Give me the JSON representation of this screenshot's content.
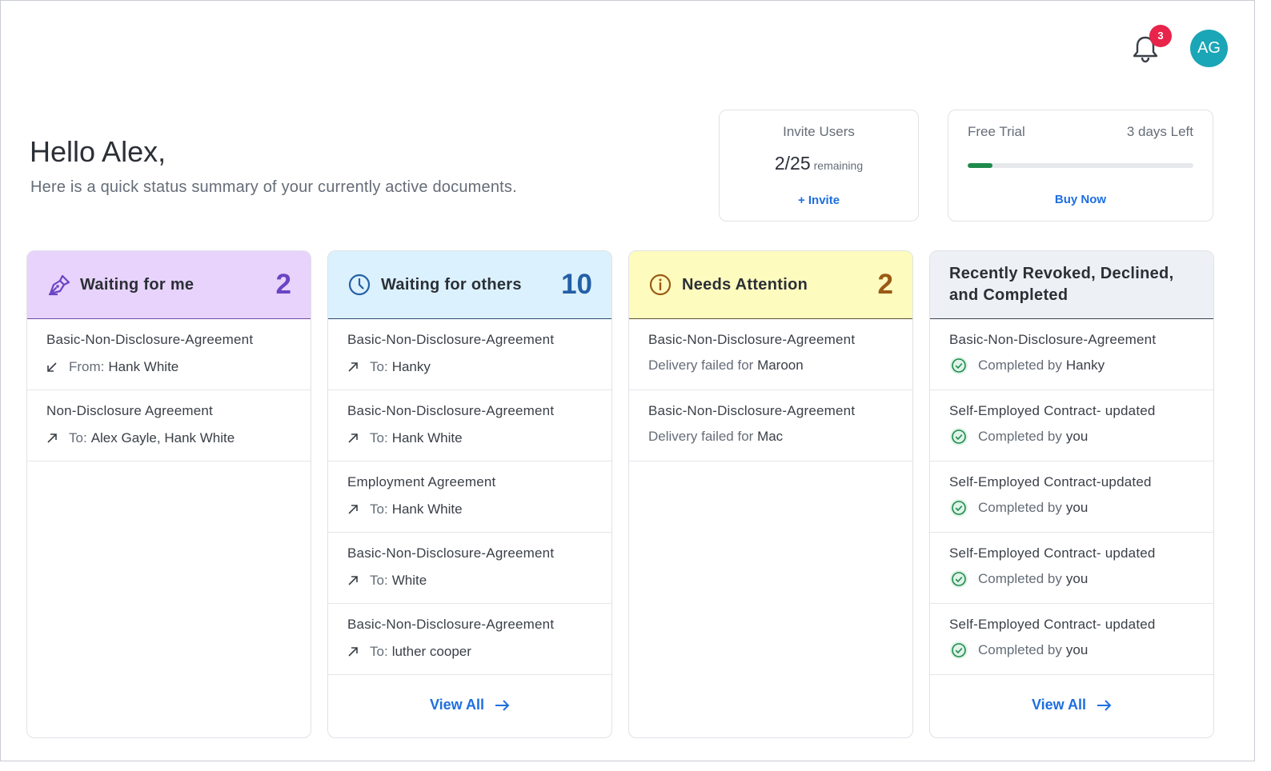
{
  "header": {
    "notification_count": "3",
    "avatar_initials": "AG"
  },
  "greeting": {
    "title": "Hello Alex,",
    "subtitle": "Here is a quick status summary of your currently active documents."
  },
  "invite_card": {
    "title": "Invite Users",
    "count": "2/25",
    "remaining_label": "remaining",
    "action": "+ Invite"
  },
  "trial_card": {
    "title": "Free Trial",
    "days_left": "3 days Left",
    "progress_fraction": 0.11,
    "action": "Buy Now",
    "progress_color": "#1e8a4c"
  },
  "columns": [
    {
      "title": "Waiting for me",
      "count": "2",
      "icon": "pen-icon",
      "accent": "#6b44c4",
      "items": [
        {
          "title": "Basic-Non-Disclosure-Agreement",
          "prefix": "From:",
          "who": "Hank White",
          "icon": "arrow-down-left-icon"
        },
        {
          "title": "Non-Disclosure Agreement",
          "prefix": "To:",
          "who": "Alex Gayle, Hank White",
          "icon": "arrow-up-right-icon"
        }
      ]
    },
    {
      "title": "Waiting for others",
      "count": "10",
      "icon": "clock-icon",
      "accent": "#245fa6",
      "items": [
        {
          "title": "Basic-Non-Disclosure-Agreement",
          "prefix": "To:",
          "who": "Hanky",
          "icon": "arrow-up-right-icon"
        },
        {
          "title": "Basic-Non-Disclosure-Agreement",
          "prefix": "To:",
          "who": "Hank White",
          "icon": "arrow-up-right-icon"
        },
        {
          "title": "Employment Agreement",
          "prefix": "To:",
          "who": "Hank White",
          "icon": "arrow-up-right-icon"
        },
        {
          "title": "Basic-Non-Disclosure-Agreement",
          "prefix": "To:",
          "who": "White",
          "icon": "arrow-up-right-icon"
        },
        {
          "title": "Basic-Non-Disclosure-Agreement",
          "prefix": "To:",
          "who": "luther cooper",
          "icon": "arrow-up-right-icon"
        }
      ],
      "view_all": "View All"
    },
    {
      "title": "Needs Attention",
      "count": "2",
      "icon": "info-icon",
      "accent": "#9a5a14",
      "items": [
        {
          "title": "Basic-Non-Disclosure-Agreement",
          "prefix": "Delivery failed for",
          "who": "Maroon"
        },
        {
          "title": "Basic-Non-Disclosure-Agreement",
          "prefix": "Delivery failed for",
          "who": "Mac"
        }
      ]
    },
    {
      "title_line1": "Recently Revoked, Declined,",
      "title_line2": "and Completed",
      "items": [
        {
          "title": "Basic-Non-Disclosure-Agreement",
          "prefix": "Completed by",
          "who": "Hanky",
          "icon": "check-circle-icon"
        },
        {
          "title": "Self-Employed Contract- updated",
          "prefix": "Completed by",
          "who": "you",
          "icon": "check-circle-icon"
        },
        {
          "title": "Self-Employed Contract-updated",
          "prefix": "Completed by",
          "who": "you",
          "icon": "check-circle-icon"
        },
        {
          "title": "Self-Employed Contract- updated",
          "prefix": "Completed by",
          "who": "you",
          "icon": "check-circle-icon"
        },
        {
          "title": "Self-Employed Contract- updated",
          "prefix": "Completed by",
          "who": "you",
          "icon": "check-circle-icon"
        }
      ],
      "view_all": "View All"
    }
  ]
}
